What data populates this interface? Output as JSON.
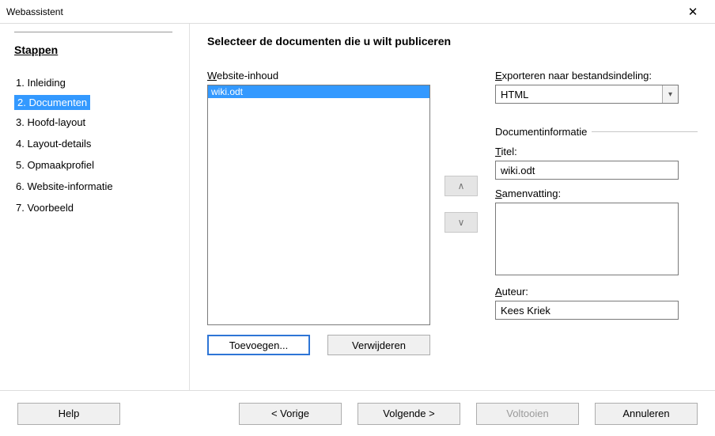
{
  "title": "Webassistent",
  "sidebar": {
    "heading": "Stappen",
    "steps": [
      "1. Inleiding",
      "2. Documenten",
      "3. Hoofd-layout",
      "4. Layout-details",
      "5. Opmaakprofiel",
      "6. Website-informatie",
      "7. Voorbeeld"
    ],
    "selectedIndex": 1
  },
  "main": {
    "heading": "Selecteer de documenten die u wilt publiceren",
    "contentLabelPrefix": "W",
    "contentLabelRest": "ebsite-inhoud",
    "items": [
      "wiki.odt"
    ],
    "selectedItemIndex": 0,
    "addLabelPrefix": "T",
    "addLabelRest": "oevoegen...",
    "removeLabelPrefix": "V",
    "removeLabelRest": "erwijderen",
    "export": {
      "labelPrefix": "E",
      "labelRest": "xporteren naar bestandsindeling:",
      "value": "HTML"
    },
    "docinfo": {
      "legend": "Documentinformatie",
      "titleLabelPrefix": "T",
      "titleLabelRest": "itel:",
      "titleValue": "wiki.odt",
      "summaryLabelPrefix": "S",
      "summaryLabelRest": "amenvatting:",
      "summaryValue": "",
      "authorLabelPrefix": "A",
      "authorLabelRest": "uteur:",
      "authorValue": "Kees Kriek"
    }
  },
  "footer": {
    "helpPrefix": "H",
    "helpRest": "elp",
    "backPrefix": "< V",
    "backRest": "orige",
    "nextPrefix": "V",
    "nextRest": "olgende >",
    "finish": "Voltooien",
    "cancel": "Annuleren"
  }
}
